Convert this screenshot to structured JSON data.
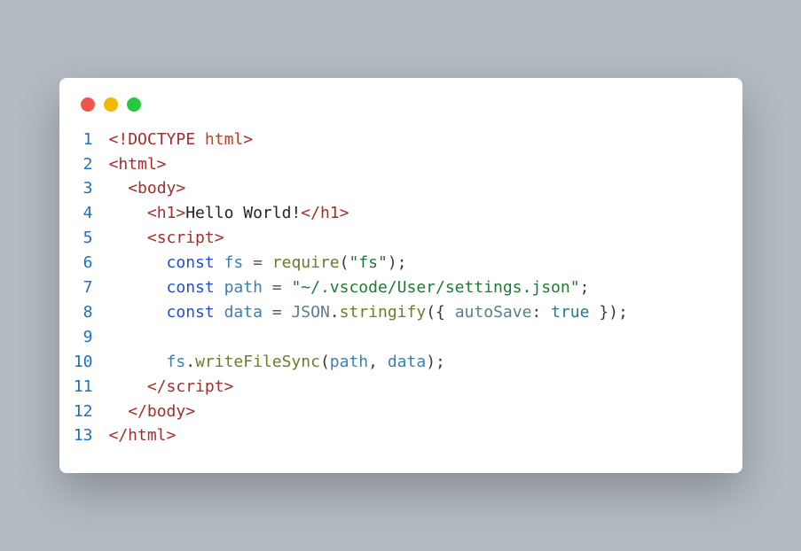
{
  "window": {
    "buttons": [
      "close",
      "minimize",
      "maximize"
    ]
  },
  "code": {
    "line_numbers": [
      "1",
      "2",
      "3",
      "4",
      "5",
      "6",
      "7",
      "8",
      "9",
      "10",
      "11",
      "12",
      "13"
    ],
    "tokens": {
      "l1_open": "<!",
      "l1_doctype": "DOCTYPE",
      "l1_space": " ",
      "l1_html": "html",
      "l1_close": ">",
      "l2": "<html>",
      "l3_indent": "  ",
      "l3": "<body>",
      "l4_indent": "    ",
      "l4_open": "<h1>",
      "l4_text": "Hello World!",
      "l4_close": "</h1>",
      "l5_indent": "    ",
      "l5": "<script>",
      "l6_indent": "      ",
      "l6_const": "const",
      "l6_sp": " ",
      "l6_fs": "fs",
      "l6_eq": " = ",
      "l6_require": "require",
      "l6_paren_o": "(",
      "l6_str": "\"fs\"",
      "l6_paren_c": ")",
      "l6_semi": ";",
      "l7_indent": "      ",
      "l7_const": "const",
      "l7_sp": " ",
      "l7_path": "path",
      "l7_eq": " = ",
      "l7_str": "\"~/.vscode/User/settings.json\"",
      "l7_semi": ";",
      "l8_indent": "      ",
      "l8_const": "const",
      "l8_sp": " ",
      "l8_data": "data",
      "l8_eq": " = ",
      "l8_json": "JSON",
      "l8_dot": ".",
      "l8_stringify": "stringify",
      "l8_paren_o": "(",
      "l8_brace_o": "{ ",
      "l8_prop": "autoSave",
      "l8_colon": ": ",
      "l8_bool": "true",
      "l8_brace_c": " }",
      "l8_paren_c": ")",
      "l8_semi": ";",
      "l9": "",
      "l10_indent": "      ",
      "l10_fs": "fs",
      "l10_dot": ".",
      "l10_write": "writeFileSync",
      "l10_paren_o": "(",
      "l10_arg1": "path",
      "l10_comma": ", ",
      "l10_arg2": "data",
      "l10_paren_c": ")",
      "l10_semi": ";",
      "l11_indent": "    ",
      "l11": "</script>",
      "l12_indent": "  ",
      "l12": "</body>",
      "l13": "</html>"
    }
  }
}
